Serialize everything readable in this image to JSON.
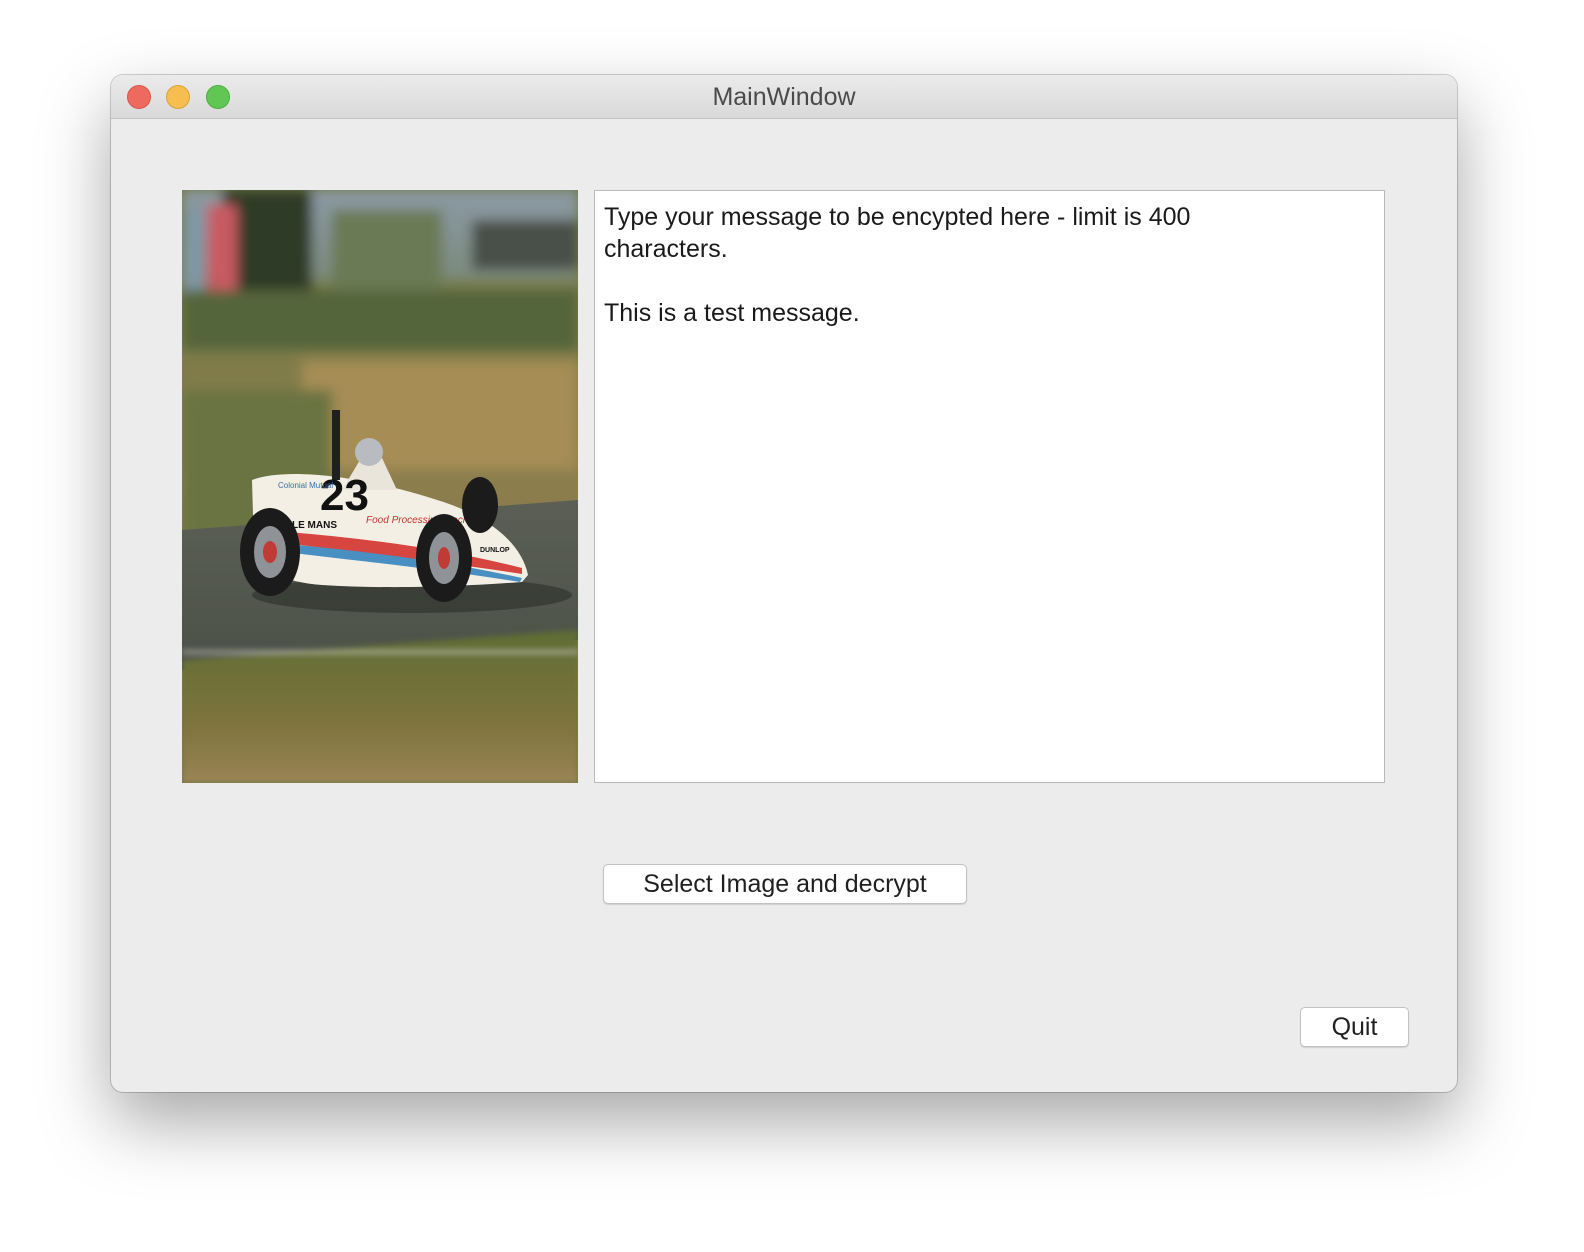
{
  "window": {
    "title": "MainWindow"
  },
  "message": {
    "lines": [
      "Type your message to be encypted here - limit is 400",
      "characters.",
      "",
      "This is a test message."
    ]
  },
  "buttons": {
    "decrypt_label": "Select Image and decrypt",
    "quit_label": "Quit"
  },
  "race_car": {
    "number": "23",
    "decal_le_mans": "LE MANS",
    "decal_food": "Food Processing Mach",
    "decal_brand": "Colonial Mutual",
    "decal_tyre": "DUNLOP"
  },
  "colors": {
    "close": "#ee6a5f",
    "minimize": "#f5be4f",
    "maximize": "#62c655",
    "window_bg": "#ececec"
  }
}
